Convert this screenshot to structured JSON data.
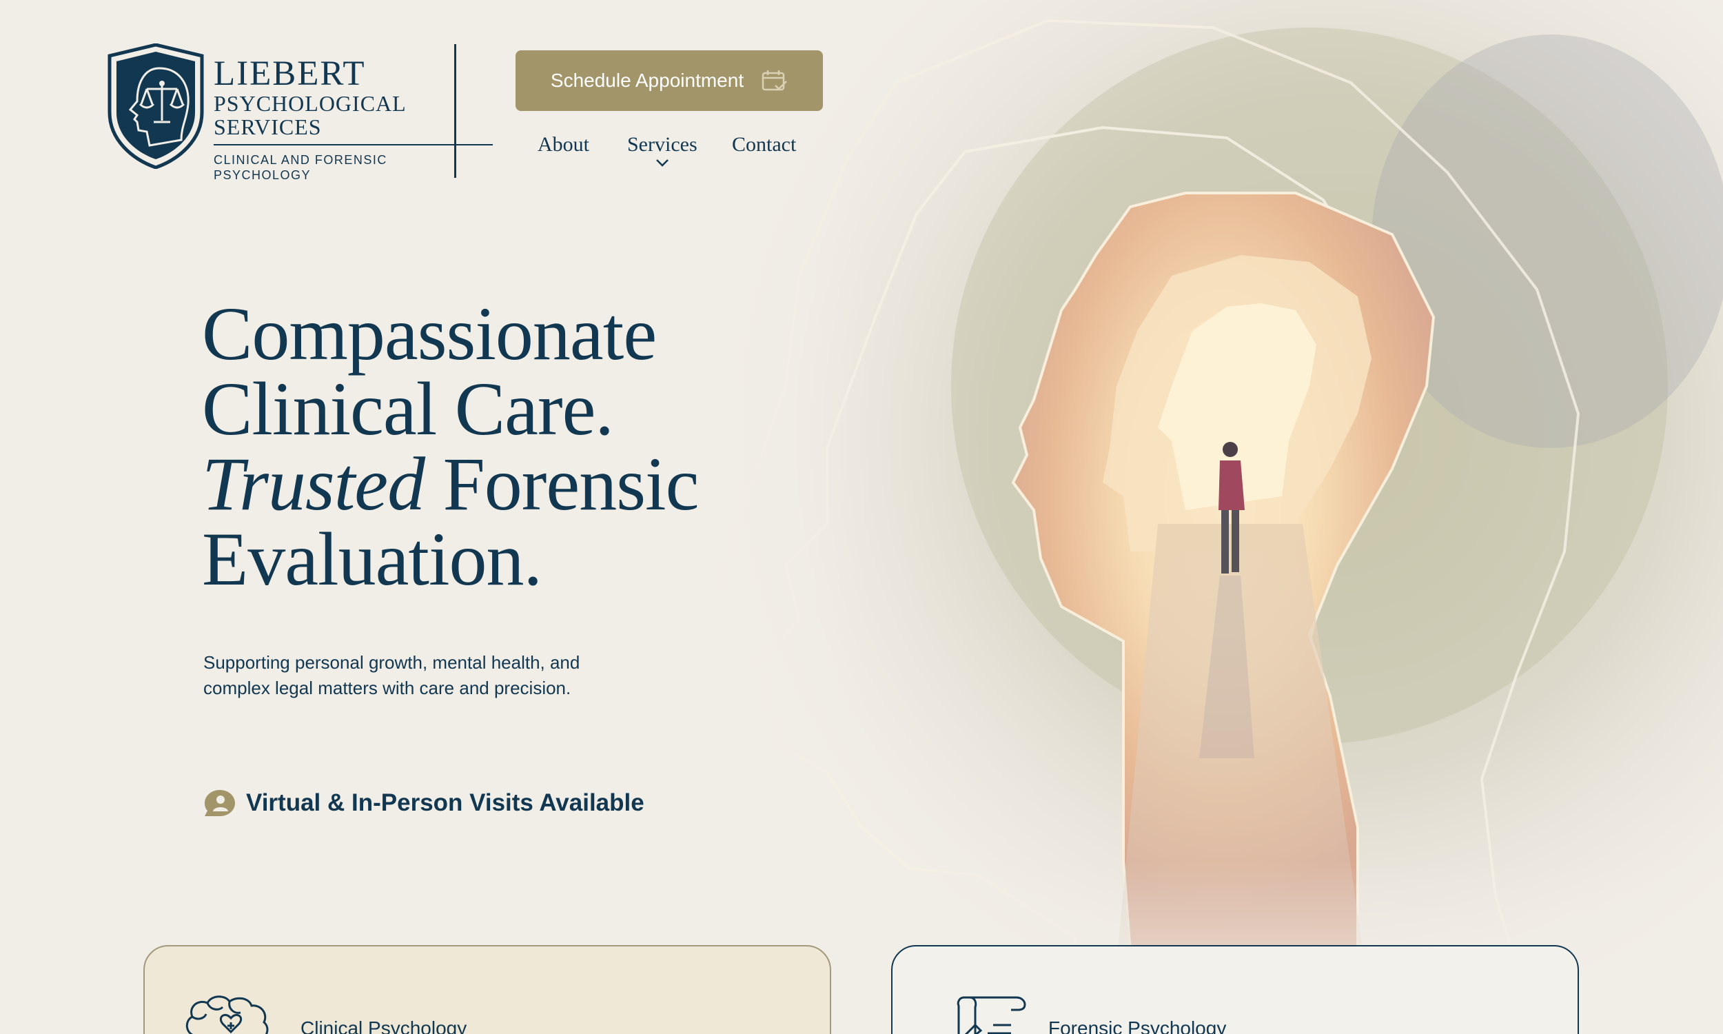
{
  "brand": {
    "name": "LIEBERT",
    "line2": "PSYCHOLOGICAL",
    "line3": "SERVICES",
    "tagline": "CLINICAL AND FORENSIC PSYCHOLOGY",
    "logo_icon": "shield-head-scales-icon",
    "colors": {
      "navy": "#123751",
      "gold": "#a2956a",
      "background": "#f1ede7"
    }
  },
  "header": {
    "cta_label": "Schedule Appointment",
    "cta_icon": "calendar-icon",
    "nav": {
      "about": "About",
      "services": "Services",
      "contact": "Contact"
    }
  },
  "hero": {
    "heading": {
      "line1": "Compassionate",
      "line2": "Clinical Care.",
      "line3_italic": "Trusted",
      "line3_rest": " Forensic",
      "line4": "Evaluation."
    },
    "subtext": "Supporting personal growth, mental health, and complex legal matters with care and precision.",
    "visits_icon": "person-chat-bubble-icon",
    "visits_label": "Virtual & In-Person Visits Available",
    "illustration": "person-standing-in-head-shaped-tunnel"
  },
  "services": {
    "cards": [
      {
        "title": "Clinical Psychology",
        "icon": "brain-heart-icon"
      },
      {
        "title": "Forensic Psychology",
        "icon": "legal-document-icon"
      }
    ]
  }
}
